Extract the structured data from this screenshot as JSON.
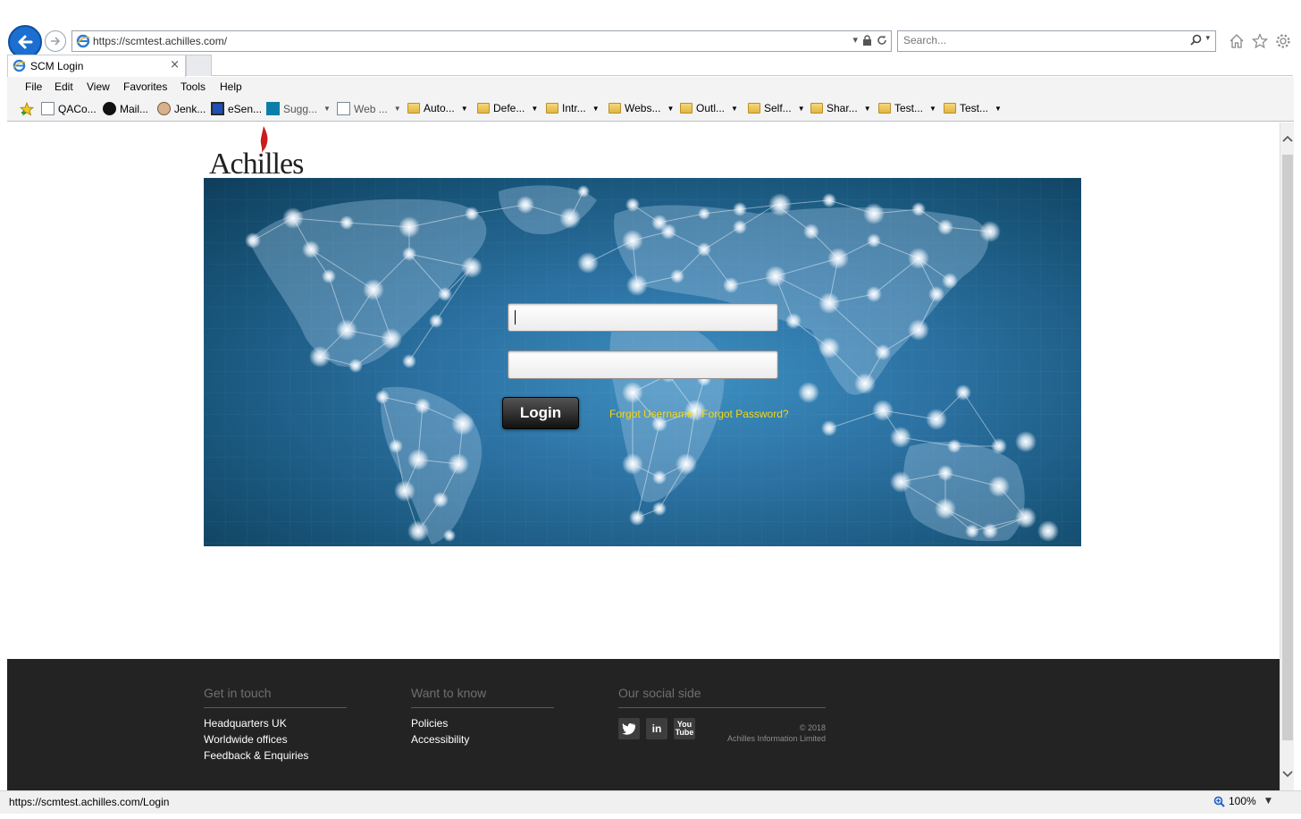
{
  "browser": {
    "url": "https://scmtest.achilles.com/",
    "search_placeholder": "Search...",
    "tab_title": "SCM Login",
    "tab_close": "×",
    "menu": [
      "File",
      "Edit",
      "View",
      "Favorites",
      "Tools",
      "Help"
    ],
    "favorites": [
      {
        "label": "QACo...",
        "icon": "ie-page-icon"
      },
      {
        "label": "Mail...",
        "icon": "github-icon"
      },
      {
        "label": "Jenk...",
        "icon": "jenkins-icon"
      },
      {
        "label": "eSen...",
        "icon": "monitor-icon"
      },
      {
        "label": "Sugg...",
        "icon": "bing-icon"
      },
      {
        "label": "Web ...",
        "icon": "ie-page-icon"
      },
      {
        "label": "Auto...",
        "icon": "folder-icon"
      },
      {
        "label": "Defe...",
        "icon": "folder-icon"
      },
      {
        "label": "Intr...",
        "icon": "folder-icon"
      },
      {
        "label": "Webs...",
        "icon": "folder-icon"
      },
      {
        "label": "Outl...",
        "icon": "folder-icon"
      },
      {
        "label": "Self...",
        "icon": "folder-icon"
      },
      {
        "label": "Shar...",
        "icon": "folder-icon"
      },
      {
        "label": "Test...",
        "icon": "folder-icon"
      },
      {
        "label": "Test...",
        "icon": "folder-icon"
      }
    ],
    "status_url": "https://scmtest.achilles.com/Login",
    "zoom": "100%"
  },
  "page": {
    "logo_text": "Achilles",
    "login": {
      "username_value": "",
      "password_value": "",
      "button_label": "Login",
      "forgot_username": "Forgot Username",
      "separator": "|",
      "forgot_password": "Forgot Password?"
    },
    "footer": {
      "col1": {
        "heading": "Get in touch",
        "links": [
          "Headquarters UK",
          "Worldwide offices",
          "Feedback & Enquiries"
        ]
      },
      "col2": {
        "heading": "Want to know",
        "links": [
          "Policies",
          "Accessibility"
        ]
      },
      "col3": {
        "heading": "Our social side",
        "social": [
          "twitter-icon",
          "linkedin-icon",
          "youtube-icon"
        ],
        "copyright_year": "© 2018",
        "copyright_owner": "Achilles Information Limited"
      }
    }
  },
  "colors": {
    "link_yellow": "#f6d70f",
    "footer_bg": "#232323",
    "hero_blue": "#2a6f9f",
    "ie_blue": "#1b6fd1"
  }
}
